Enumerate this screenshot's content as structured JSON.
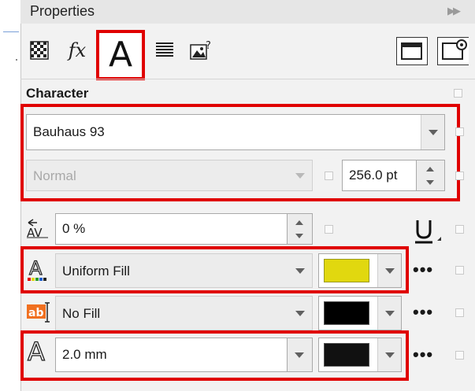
{
  "docker": {
    "title": "Properties",
    "collapse_icon": "double-chevron-right-icon"
  },
  "tabs": [
    {
      "name": "texture-icon"
    },
    {
      "name": "fx-icon",
      "label": "fx"
    },
    {
      "name": "character-A-icon",
      "label": "A",
      "selected": true
    },
    {
      "name": "paragraph-lines-icon"
    },
    {
      "name": "image-question-icon",
      "label": "?"
    }
  ],
  "section": {
    "heading": "Character"
  },
  "font": {
    "family": "Bauhaus 93",
    "style": "Normal",
    "size": "256.0 pt"
  },
  "kerning": {
    "value": "0 %"
  },
  "fill": {
    "type": "Uniform Fill",
    "color": "#e1d80f"
  },
  "background_fill": {
    "type": "No Fill",
    "color": "#000000"
  },
  "outline": {
    "width": "2.0 mm",
    "color": "#111111"
  },
  "colors": {
    "highlight": "#e00000",
    "panel_bg": "#f2f2f2",
    "accent_orange": "#f07020"
  }
}
